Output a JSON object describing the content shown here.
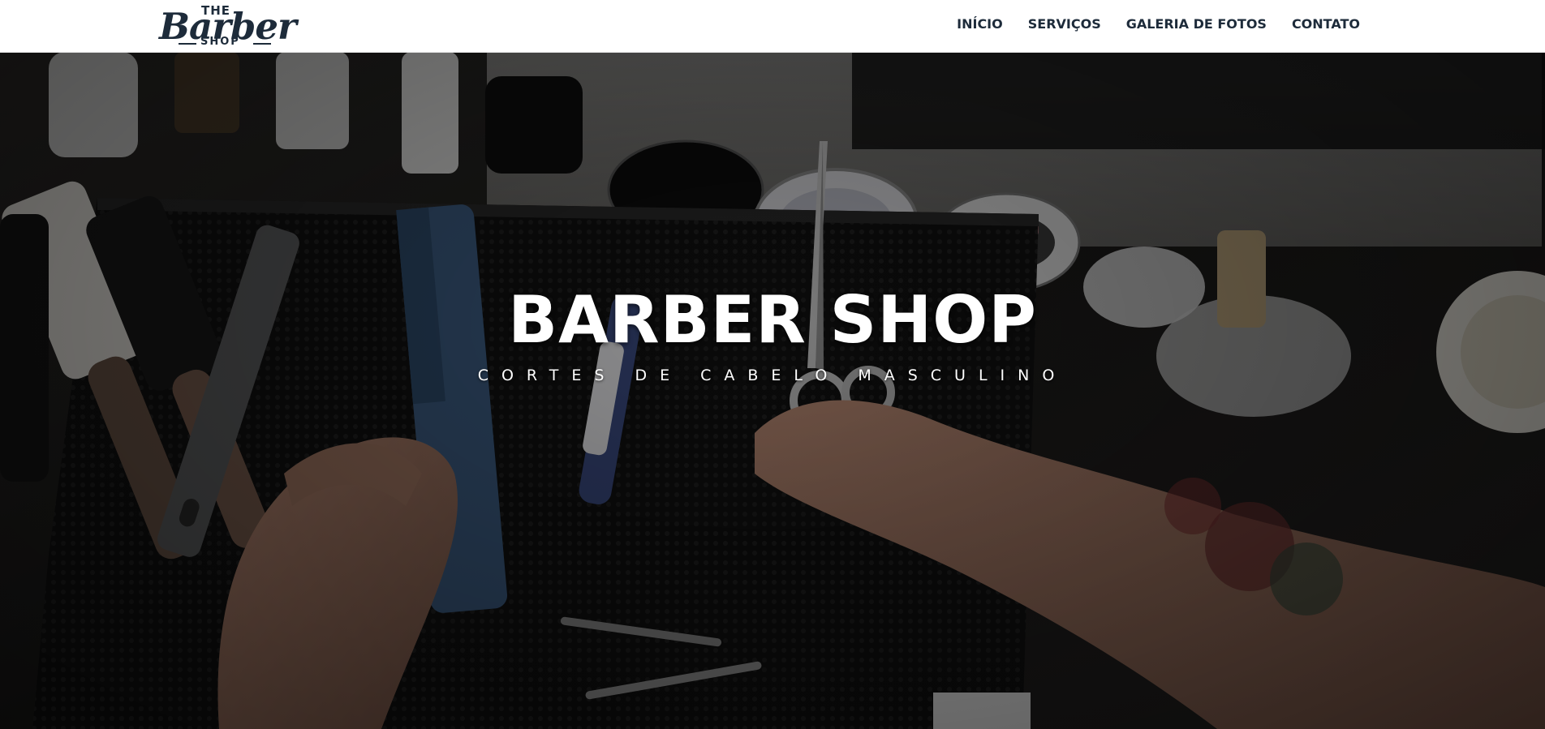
{
  "header": {
    "logo": {
      "the": "THE",
      "barber": "Barber",
      "shop": "SHOP"
    },
    "nav": [
      {
        "label": "INÍCIO"
      },
      {
        "label": "SERVIÇOS"
      },
      {
        "label": "GALERIA DE FOTOS"
      },
      {
        "label": "CONTATO"
      }
    ]
  },
  "hero": {
    "title": "BARBER SHOP",
    "subtitle": "CORTES DE CABELO MASCULINO"
  },
  "colors": {
    "header_bg": "#ffffff",
    "nav_text": "#1d2b3a",
    "hero_text": "#ffffff"
  }
}
